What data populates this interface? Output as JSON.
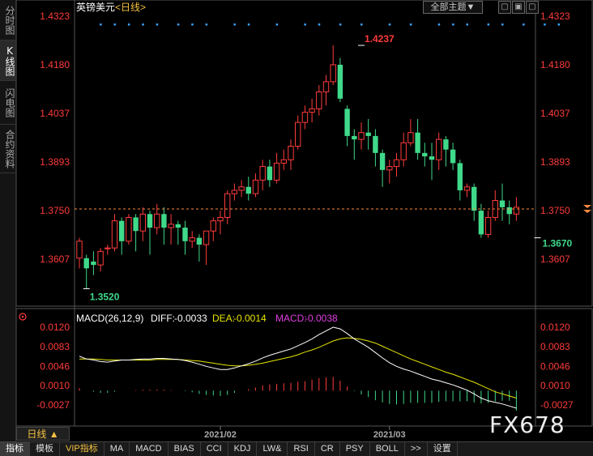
{
  "sidebar": {
    "tabs": [
      {
        "label": "分时图",
        "active": false
      },
      {
        "label": "K线图",
        "active": true
      },
      {
        "label": "闪电图",
        "active": false
      },
      {
        "label": "合约资料",
        "active": false
      }
    ]
  },
  "header": {
    "symbol": "英镑美元",
    "period": "<日线>",
    "theme_dropdown": "全部主题▼"
  },
  "colors": {
    "up": "#ff3b3b",
    "down": "#3fd98a",
    "macd_diff": "#ffffff",
    "macd_dea": "#e6e600",
    "macd_label": "#e040e0"
  },
  "chart_data": {
    "type": "candlestick",
    "title": "英镑美元<日线>",
    "price_ticks": [
      "1.4323",
      "1.4180",
      "1.4037",
      "1.3893",
      "1.3750",
      "1.3607"
    ],
    "x_ticks": [
      {
        "label": "2021/02",
        "index": 20
      },
      {
        "label": "2021/03",
        "index": 44
      }
    ],
    "annotations": {
      "high": {
        "label": "1.4237",
        "value": 1.4237,
        "index": 40
      },
      "low": {
        "label": "1.3520",
        "value": 1.352,
        "index": 1
      },
      "recent_low": {
        "label": "1.3670",
        "value": 1.367,
        "index": 65
      }
    },
    "current_price_line": 1.3755,
    "ohlc": [
      [
        1.361,
        1.366,
        1.358,
        1.367
      ],
      [
        1.361,
        1.358,
        1.352,
        1.362
      ],
      [
        1.36,
        1.359,
        1.356,
        1.363
      ],
      [
        1.359,
        1.363,
        1.357,
        1.364
      ],
      [
        1.364,
        1.364,
        1.362,
        1.365
      ],
      [
        1.364,
        1.372,
        1.363,
        1.374
      ],
      [
        1.372,
        1.366,
        1.362,
        1.373
      ],
      [
        1.366,
        1.373,
        1.365,
        1.374
      ],
      [
        1.373,
        1.369,
        1.363,
        1.374
      ],
      [
        1.369,
        1.374,
        1.366,
        1.376
      ],
      [
        1.374,
        1.37,
        1.362,
        1.375
      ],
      [
        1.37,
        1.374,
        1.368,
        1.377
      ],
      [
        1.374,
        1.37,
        1.365,
        1.376
      ],
      [
        1.37,
        1.371,
        1.365,
        1.374
      ],
      [
        1.371,
        1.37,
        1.365,
        1.372
      ],
      [
        1.37,
        1.366,
        1.362,
        1.372
      ],
      [
        1.366,
        1.367,
        1.364,
        1.369
      ],
      [
        1.367,
        1.365,
        1.36,
        1.368
      ],
      [
        1.365,
        1.369,
        1.359,
        1.369
      ],
      [
        1.369,
        1.372,
        1.366,
        1.373
      ],
      [
        1.372,
        1.373,
        1.368,
        1.375
      ],
      [
        1.373,
        1.38,
        1.371,
        1.381
      ],
      [
        1.38,
        1.381,
        1.378,
        1.383
      ],
      [
        1.381,
        1.382,
        1.379,
        1.384
      ],
      [
        1.382,
        1.38,
        1.378,
        1.385
      ],
      [
        1.38,
        1.384,
        1.379,
        1.386
      ],
      [
        1.384,
        1.388,
        1.381,
        1.39
      ],
      [
        1.388,
        1.384,
        1.382,
        1.39
      ],
      [
        1.384,
        1.389,
        1.383,
        1.392
      ],
      [
        1.389,
        1.39,
        1.387,
        1.393
      ],
      [
        1.39,
        1.394,
        1.387,
        1.396
      ],
      [
        1.394,
        1.401,
        1.393,
        1.403
      ],
      [
        1.401,
        1.404,
        1.399,
        1.406
      ],
      [
        1.404,
        1.405,
        1.401,
        1.408
      ],
      [
        1.405,
        1.41,
        1.403,
        1.412
      ],
      [
        1.41,
        1.413,
        1.406,
        1.415
      ],
      [
        1.413,
        1.418,
        1.412,
        1.4237
      ],
      [
        1.418,
        1.408,
        1.407,
        1.42
      ],
      [
        1.405,
        1.397,
        1.394,
        1.406
      ],
      [
        1.397,
        1.396,
        1.39,
        1.399
      ],
      [
        1.396,
        1.398,
        1.393,
        1.401
      ],
      [
        1.398,
        1.397,
        1.393,
        1.402
      ],
      [
        1.397,
        1.392,
        1.388,
        1.399
      ],
      [
        1.392,
        1.387,
        1.382,
        1.393
      ],
      [
        1.387,
        1.388,
        1.383,
        1.39
      ],
      [
        1.388,
        1.39,
        1.385,
        1.392
      ],
      [
        1.39,
        1.395,
        1.388,
        1.398
      ],
      [
        1.395,
        1.398,
        1.394,
        1.402
      ],
      [
        1.398,
        1.392,
        1.39,
        1.402
      ],
      [
        1.392,
        1.391,
        1.388,
        1.395
      ],
      [
        1.391,
        1.39,
        1.384,
        1.395
      ],
      [
        1.39,
        1.396,
        1.387,
        1.398
      ],
      [
        1.396,
        1.393,
        1.388,
        1.397
      ],
      [
        1.393,
        1.389,
        1.387,
        1.395
      ],
      [
        1.389,
        1.381,
        1.378,
        1.39
      ],
      [
        1.381,
        1.382,
        1.379,
        1.383
      ],
      [
        1.382,
        1.375,
        1.372,
        1.383
      ],
      [
        1.375,
        1.368,
        1.367,
        1.377
      ],
      [
        1.368,
        1.373,
        1.367,
        1.375
      ],
      [
        1.373,
        1.378,
        1.372,
        1.381
      ],
      [
        1.378,
        1.376,
        1.372,
        1.383
      ],
      [
        1.376,
        1.374,
        1.371,
        1.378
      ],
      [
        1.374,
        1.376,
        1.372,
        1.379
      ]
    ],
    "markers_top": [
      3,
      5,
      7,
      9,
      11,
      14,
      16,
      18,
      22,
      24,
      28,
      32,
      34,
      37,
      40,
      44,
      47,
      51,
      53,
      55,
      58,
      60,
      63,
      66,
      68
    ],
    "macd": {
      "label": "MACD(26,12,9)",
      "diff": {
        "label": "DIFF:",
        "value": "-0.0033"
      },
      "dea": {
        "label": "DEA:",
        "value": "-0.0014"
      },
      "hist": {
        "label": "MACD:",
        "value": "-0.0038"
      },
      "ticks": [
        "0.0120",
        "0.0083",
        "0.0046",
        "0.0010",
        "-0.0027"
      ],
      "diff_series": [
        0.0065,
        0.006,
        0.0058,
        0.0055,
        0.0054,
        0.0056,
        0.0058,
        0.0058,
        0.0059,
        0.006,
        0.006,
        0.0061,
        0.0061,
        0.006,
        0.0059,
        0.0057,
        0.0054,
        0.005,
        0.0046,
        0.0043,
        0.004,
        0.004,
        0.0043,
        0.0047,
        0.0051,
        0.0056,
        0.0062,
        0.0067,
        0.0071,
        0.0075,
        0.0079,
        0.0085,
        0.0091,
        0.0098,
        0.0106,
        0.0113,
        0.012,
        0.0117,
        0.0108,
        0.0098,
        0.009,
        0.0082,
        0.0072,
        0.0062,
        0.0053,
        0.0046,
        0.0041,
        0.0037,
        0.0032,
        0.0027,
        0.0022,
        0.0019,
        0.0015,
        0.0011,
        0.0006,
        0.0001,
        -0.0006,
        -0.0014,
        -0.0019,
        -0.0022,
        -0.0025,
        -0.0029,
        -0.0033
      ],
      "dea_series": [
        0.006,
        0.006,
        0.006,
        0.0059,
        0.0058,
        0.0058,
        0.0058,
        0.0058,
        0.0058,
        0.0058,
        0.0058,
        0.0059,
        0.0059,
        0.0059,
        0.0059,
        0.0058,
        0.0057,
        0.0056,
        0.0054,
        0.0052,
        0.005,
        0.0048,
        0.0047,
        0.0047,
        0.0048,
        0.005,
        0.0052,
        0.0055,
        0.0058,
        0.0061,
        0.0064,
        0.0068,
        0.0073,
        0.0077,
        0.0082,
        0.0088,
        0.0094,
        0.0098,
        0.01,
        0.0099,
        0.0097,
        0.0094,
        0.009,
        0.0084,
        0.0078,
        0.0072,
        0.0066,
        0.006,
        0.0055,
        0.005,
        0.0045,
        0.004,
        0.0035,
        0.0031,
        0.0026,
        0.0021,
        0.0016,
        0.001,
        0.0004,
        -0.0002,
        -0.0006,
        -0.001,
        -0.0014
      ],
      "hist_series": [
        0.0005,
        0.0,
        -0.0002,
        -0.0004,
        -0.0004,
        -0.0002,
        0.0,
        0.0,
        0.0001,
        0.0002,
        0.0002,
        0.0002,
        0.0002,
        0.0001,
        0.0,
        -0.0001,
        -0.0003,
        -0.0006,
        -0.0008,
        -0.0009,
        -0.001,
        -0.0008,
        -0.0004,
        0.0,
        0.0003,
        0.0006,
        0.001,
        0.0012,
        0.0013,
        0.0014,
        0.0015,
        0.0017,
        0.0018,
        0.0021,
        0.0024,
        0.0025,
        0.0026,
        0.0019,
        0.0008,
        -0.0001,
        -0.0007,
        -0.0012,
        -0.0018,
        -0.0022,
        -0.0025,
        -0.0026,
        -0.0025,
        -0.0023,
        -0.0023,
        -0.0023,
        -0.0023,
        -0.0021,
        -0.002,
        -0.002,
        -0.002,
        -0.002,
        -0.0022,
        -0.0024,
        -0.0023,
        -0.002,
        -0.0019,
        -0.0019,
        -0.0038
      ]
    }
  },
  "footer": {
    "period_button": "日线 ▲",
    "tabs": [
      "指标",
      "模板",
      "VIP指标",
      "MA",
      "MACD",
      "BIAS",
      "CCI",
      "KDJ",
      "LW&",
      "RSI",
      "CR",
      "PSY",
      "BOLL",
      ">>",
      "设置"
    ]
  },
  "watermark": "FX678"
}
